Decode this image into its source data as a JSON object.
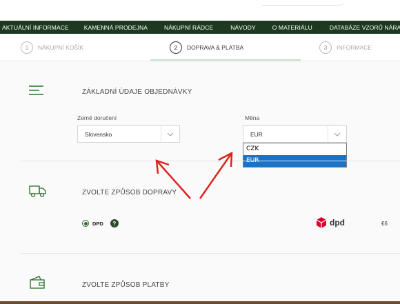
{
  "nav": {
    "items": [
      "AKTUÁLNÍ INFORMACE",
      "KAMENNÁ PRODEJNA",
      "NÁKUPNÍ RÁDCE",
      "NÁVODY",
      "O MATERIÁLU",
      "DATABÁZE VZORŮ NÁRAMKŮ"
    ]
  },
  "steps": [
    {
      "num": "1",
      "label": "NÁKUPNÍ KOŠÍK",
      "active": false
    },
    {
      "num": "2",
      "label": "DOPRAVA & PLATBA",
      "active": true
    },
    {
      "num": "3",
      "label": "INFORMACE",
      "active": false
    }
  ],
  "order": {
    "title": "ZÁKLADNÍ ÚDAJE OBJEDNÁVKY",
    "country_label": "Země doručení",
    "country_value": "Slovensko",
    "currency_label": "Měna",
    "currency_value": "EUR",
    "currency_options": [
      "CZK",
      "EUR"
    ],
    "currency_selected": "EUR"
  },
  "shipping": {
    "title": "ZVOLTE ZPŮSOB DOPRAVY",
    "options": [
      {
        "label": "DPD",
        "help": "?",
        "carrier_logo": "dpd",
        "price": "€6",
        "selected": true
      }
    ]
  },
  "payment": {
    "title": "ZVOLTE ZPŮSOB PLATBY"
  },
  "icons": {
    "order": "hamburger-icon",
    "shipping": "truck-icon",
    "payment": "wallet-icon",
    "annotation": "red-arrow-icon"
  },
  "colors": {
    "nav_bg": "#1d3a21",
    "accent": "#2c6e2c",
    "dropdown_highlight": "#1a73c9",
    "dpd_red": "#dc0032",
    "annotation_red": "#e0211b"
  }
}
